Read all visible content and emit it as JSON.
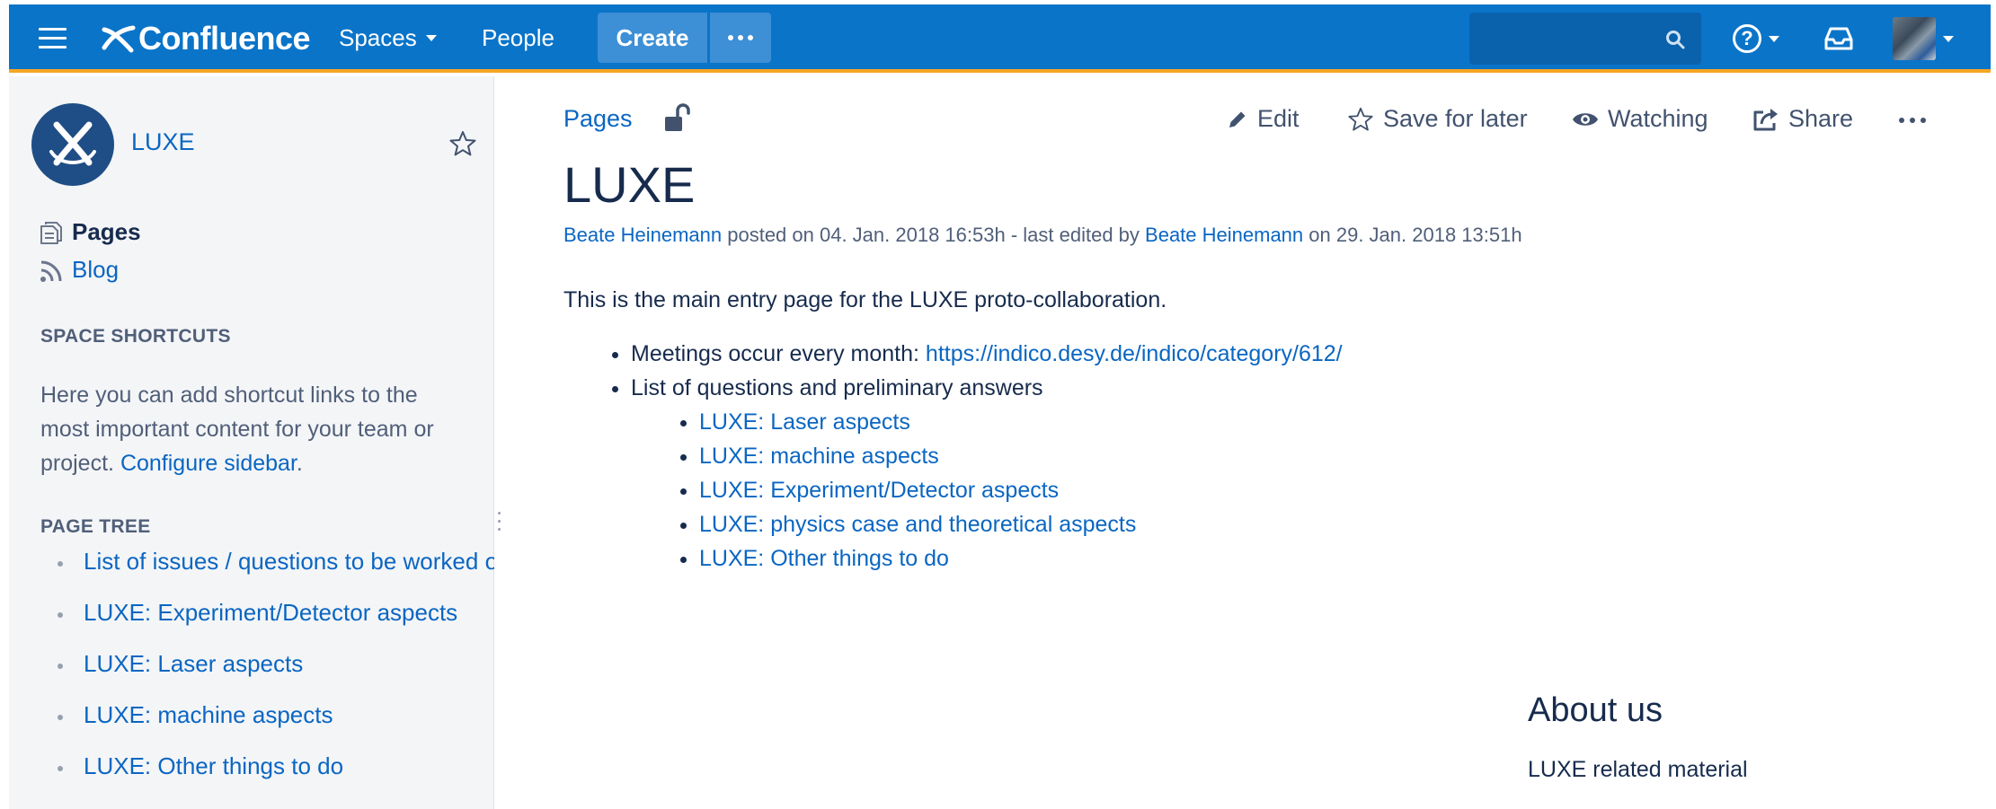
{
  "header": {
    "logo_text": "Confluence",
    "nav": {
      "spaces": "Spaces",
      "people": "People"
    },
    "create_label": "Create",
    "colors": {
      "bar": "#0a74c9",
      "accent": "#f6a623"
    }
  },
  "sidebar": {
    "space_name": "LUXE",
    "links": {
      "pages": "Pages",
      "blog": "Blog"
    },
    "shortcuts_heading": "SPACE SHORTCUTS",
    "shortcuts_text": "Here you can add shortcut links to the most important content for your team or project. ",
    "configure_link": "Configure sidebar",
    "configure_suffix": ".",
    "tree_heading": "PAGE TREE",
    "tree": [
      "List of issues / questions to be worked on",
      "LUXE: Experiment/Detector aspects",
      "LUXE: Laser aspects",
      "LUXE: machine aspects",
      "LUXE: Other things to do"
    ]
  },
  "page": {
    "breadcrumb": "Pages",
    "actions": {
      "edit": "Edit",
      "save": "Save for later",
      "watching": "Watching",
      "share": "Share"
    },
    "title": "LUXE",
    "byline": {
      "author": "Beate Heinemann",
      "posted": " posted on 04. Jan. 2018 16:53h - last edited by ",
      "editor": "Beate Heinemann",
      "edited": " on 29. Jan. 2018 13:51h"
    },
    "intro": "This is the main entry page for the LUXE proto-collaboration.",
    "meetings_text": "Meetings occur every month: ",
    "meetings_link": "https://indico.desy.de/indico/category/612/",
    "questions_text": "List of questions and preliminary answers",
    "questions": [
      "LUXE: Laser aspects",
      "LUXE: machine aspects",
      "LUXE: Experiment/Detector aspects",
      "LUXE: physics case and theoretical aspects",
      "LUXE: Other things to do"
    ],
    "about_title": "About us",
    "about_text": "LUXE related material"
  }
}
